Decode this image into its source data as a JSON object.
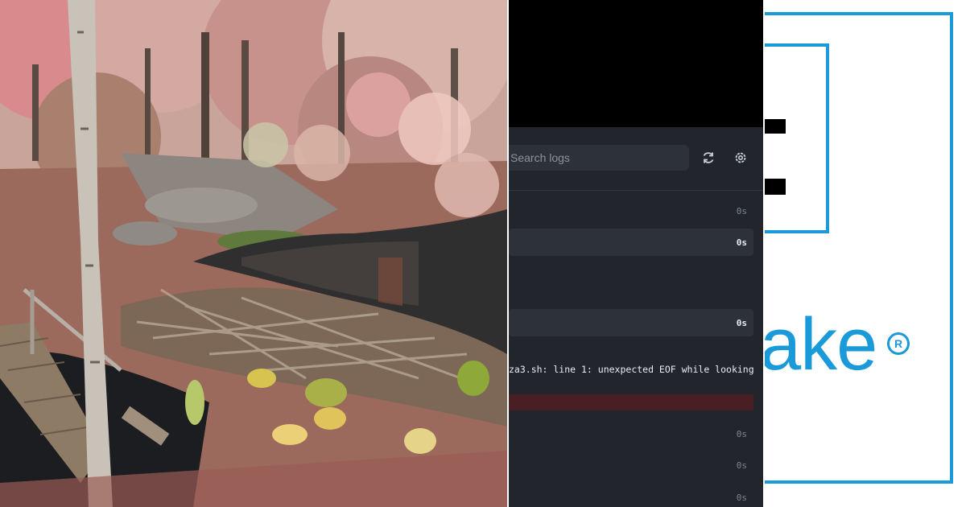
{
  "photo": {
    "subject": ""
  },
  "log_viewer": {
    "search_placeholder": "Search logs",
    "refresh_icon": "refresh-icon",
    "settings_icon": "gear-icon",
    "rows": [
      {
        "kind": "line",
        "time": "0s"
      },
      {
        "kind": "step",
        "time": "0s"
      },
      {
        "kind": "step",
        "time": "0s"
      },
      {
        "kind": "line",
        "time": "0s"
      },
      {
        "kind": "line",
        "time": "0s"
      },
      {
        "kind": "line",
        "time": "0s"
      }
    ],
    "error_text": "za3.sh: line 1: unexpected EOF while looking",
    "colors": {
      "background": "#22262c",
      "step": "#2d323a",
      "error": "#4a1f24"
    }
  },
  "logo": {
    "word": "ake",
    "registered_mark": "R",
    "accent_color": "#1a9ad9"
  }
}
